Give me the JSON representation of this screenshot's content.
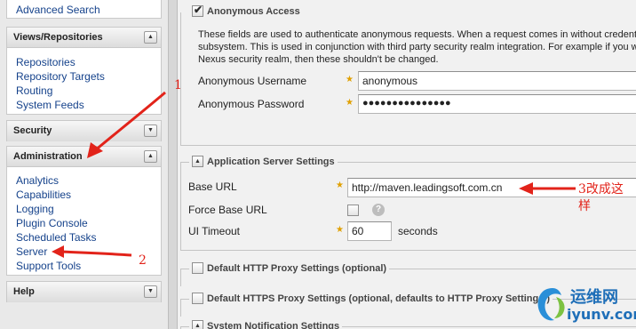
{
  "sidebar": {
    "top_link": "Advanced Search",
    "views_panel": {
      "title": "Views/Repositories",
      "items": [
        "Repositories",
        "Repository Targets",
        "Routing",
        "System Feeds"
      ]
    },
    "security_panel": {
      "title": "Security"
    },
    "admin_panel": {
      "title": "Administration",
      "items": [
        "Analytics",
        "Capabilities",
        "Logging",
        "Plugin Console",
        "Scheduled Tasks",
        "Server",
        "Support Tools"
      ]
    },
    "help_panel": {
      "title": "Help"
    }
  },
  "main": {
    "anonymous": {
      "legend": "Anonymous Access",
      "checked": true,
      "description": "These fields are used to authenticate anonymous requests. When a request comes in without credentia subsystem. This is used in conjunction with third party security realm integration. For example if you w Nexus security realm, then these shouldn't be changed.",
      "username_label": "Anonymous Username",
      "username_value": "anonymous",
      "password_label": "Anonymous Password",
      "password_value": "●●●●●●●●●●●●●●●"
    },
    "app_server": {
      "legend": "Application Server Settings",
      "base_url_label": "Base URL",
      "base_url_value": "http://maven.leadingsoft.com.cn",
      "force_base_url_label": "Force Base URL",
      "force_base_url_checked": false,
      "ui_timeout_label": "UI Timeout",
      "ui_timeout_value": "60",
      "ui_timeout_unit": "seconds"
    },
    "http_proxy": {
      "legend": "Default HTTP Proxy Settings (optional)",
      "checked": false
    },
    "https_proxy": {
      "legend": "Default HTTPS Proxy Settings (optional, defaults to HTTP Proxy Settings )",
      "checked": false
    },
    "system_notification": {
      "legend": "System Notification Settings"
    }
  },
  "annotations": {
    "label_1": "1",
    "label_2": "2",
    "label_3": "3改成这样",
    "color": "#e2231a"
  },
  "watermark": {
    "text_cn": "运维网",
    "text_en": "iyunv.com"
  }
}
